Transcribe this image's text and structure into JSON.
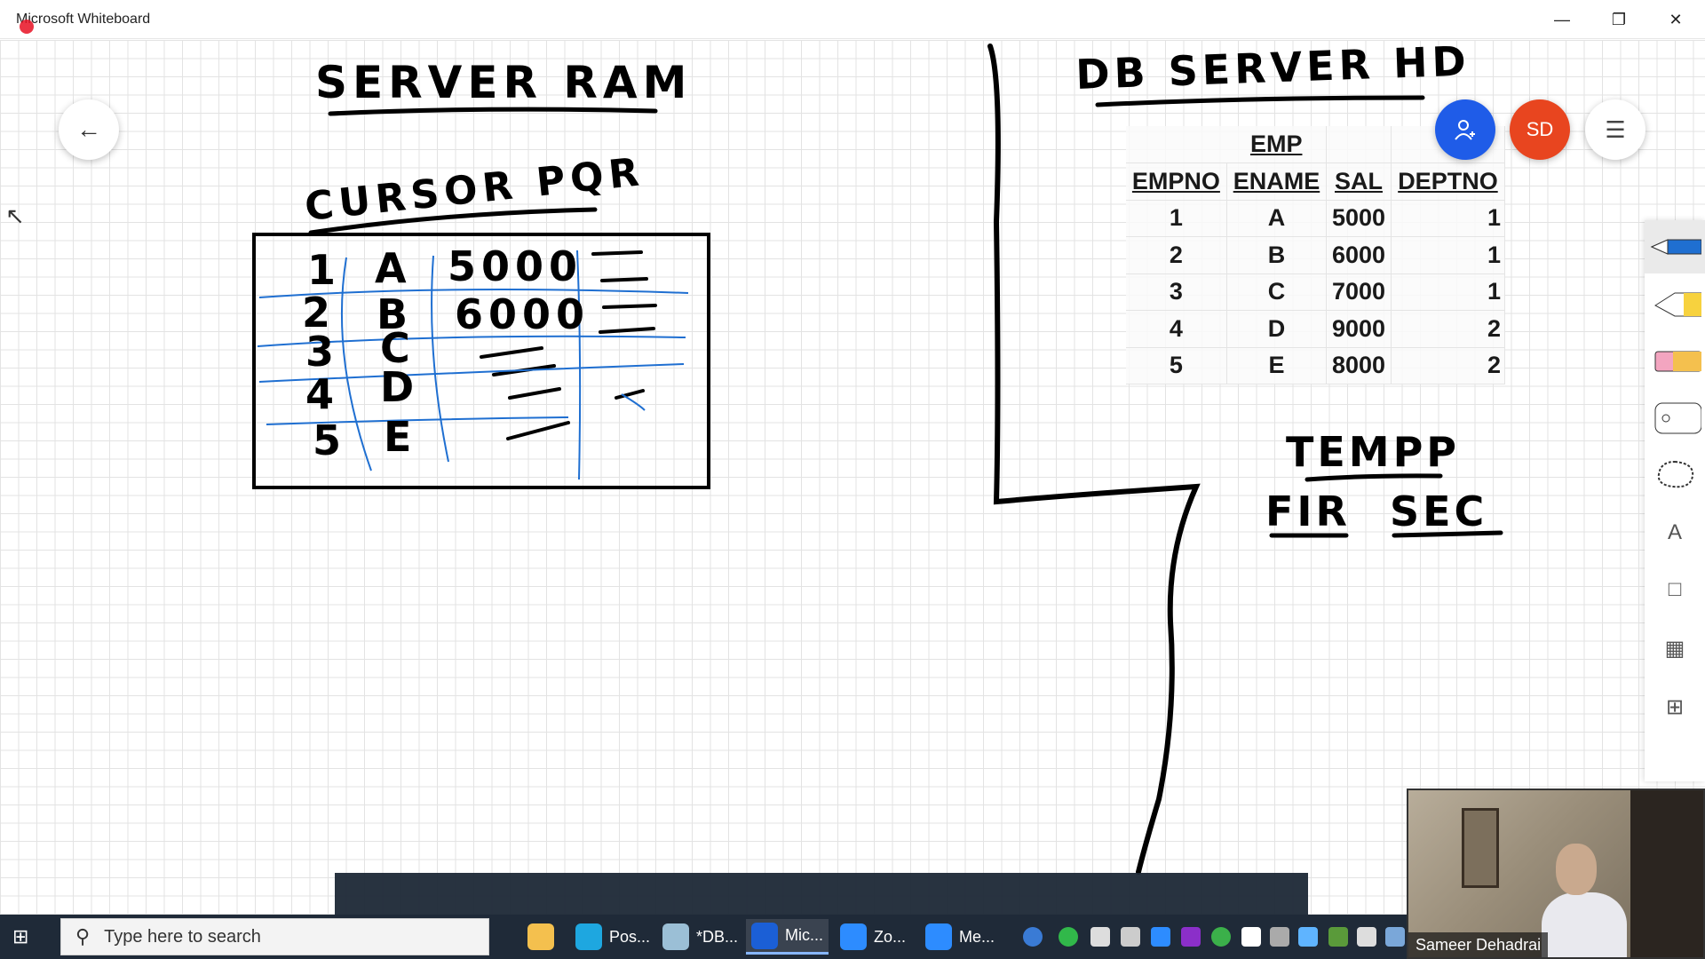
{
  "window": {
    "title": "Microsoft Whiteboard",
    "controls": [
      "minimize",
      "restore",
      "close"
    ]
  },
  "canvas_text": {
    "left_heading": "SERVER RAM",
    "cursor_label": "CURSOR PQR",
    "right_heading": "DB SERVER HD",
    "tempp": "TEMPP",
    "fir": "FIR",
    "sec": "SEC"
  },
  "ram_rows": [
    {
      "num": "1",
      "name": "A",
      "sal": "5000"
    },
    {
      "num": "2",
      "name": "B",
      "sal": "6000"
    },
    {
      "num": "3",
      "name": "C",
      "sal": ""
    },
    {
      "num": "4",
      "name": "D",
      "sal": ""
    },
    {
      "num": "5",
      "name": "E",
      "sal": ""
    }
  ],
  "emp_table": {
    "caption": "EMP",
    "headers": [
      "EMPNO",
      "ENAME",
      "SAL",
      "DEPTNO"
    ],
    "rows": [
      [
        "1",
        "A",
        "5000",
        "1"
      ],
      [
        "2",
        "B",
        "6000",
        "1"
      ],
      [
        "3",
        "C",
        "7000",
        "1"
      ],
      [
        "4",
        "D",
        "9000",
        "2"
      ],
      [
        "5",
        "E",
        "8000",
        "2"
      ]
    ]
  },
  "top_buttons": {
    "avatar_initials": "SD"
  },
  "toolbar": {
    "text_tool": "A"
  },
  "taskbar": {
    "search_placeholder": "Type here to search",
    "apps": [
      {
        "label": "Pos...",
        "icon": "edge-icon",
        "color": "#1ea7e0"
      },
      {
        "label": "*DB...",
        "icon": "notepad-icon",
        "color": "#9bbfd6"
      },
      {
        "label": "Mic...",
        "icon": "whiteboard-icon",
        "color": "#1b5fd6"
      },
      {
        "label": "Zo...",
        "icon": "zoom-icon",
        "color": "#2d8cff"
      },
      {
        "label": "Me...",
        "icon": "zoom-meeting-icon",
        "color": "#2d8cff"
      }
    ]
  },
  "webcam": {
    "participant_name": "Sameer Dehadrai"
  },
  "colors": {
    "ink_black": "#000000",
    "ink_blue": "#1f6fd1",
    "collab_blue": "#1f5ce8",
    "avatar_orange": "#e8451f"
  }
}
